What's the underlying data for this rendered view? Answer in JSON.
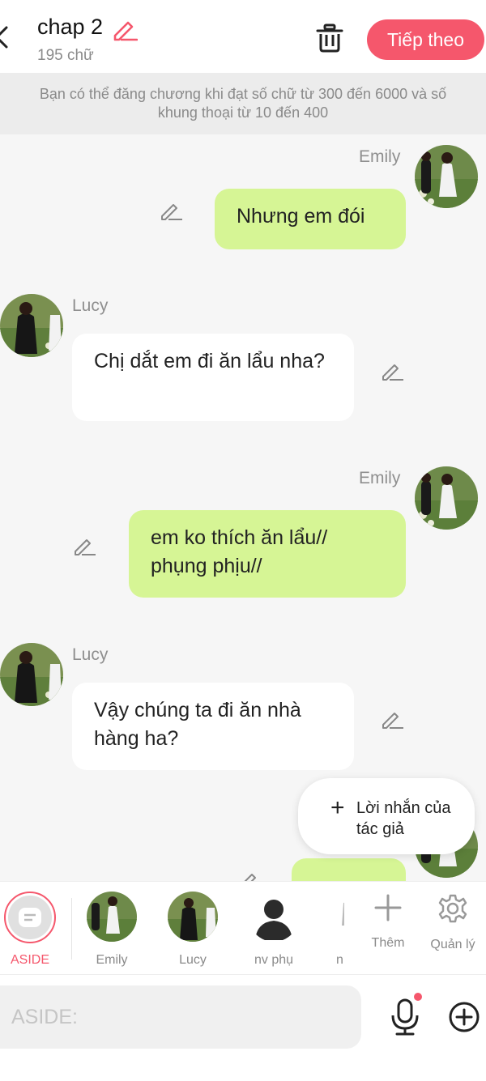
{
  "header": {
    "title": "chap 2",
    "word_count": "195 chữ",
    "next_label": "Tiếp theo",
    "accent_color": "#f5576c"
  },
  "notice": {
    "text": "Bạn có thể đăng chương khi đạt số chữ từ 300 đến 6000 và số khung thoại từ 10 đến 400"
  },
  "chat": {
    "messages": [
      {
        "speaker": "Emily",
        "side": "right",
        "text": "Nhưng em đói"
      },
      {
        "speaker": "Lucy",
        "side": "left",
        "text": "Chị dắt em đi ăn lẩu nha?"
      },
      {
        "speaker": "Emily",
        "side": "right",
        "text": "em ko thích ăn lẩu// phụng phịu//"
      },
      {
        "speaker": "Lucy",
        "side": "left",
        "text": "Vậy chúng ta đi ăn nhà hàng ha?"
      }
    ],
    "author_note": {
      "icon": "plus-icon",
      "label": "Lời nhắn của tác giả"
    }
  },
  "characters": {
    "items": [
      {
        "label": "ASIDE",
        "selected": true
      },
      {
        "label": "Emily"
      },
      {
        "label": "Lucy"
      },
      {
        "label": "nv phụ"
      },
      {
        "label": "n"
      }
    ],
    "add_label": "Thêm",
    "manage_label": "Quản lý"
  },
  "input": {
    "placeholder": "ASIDE:"
  }
}
